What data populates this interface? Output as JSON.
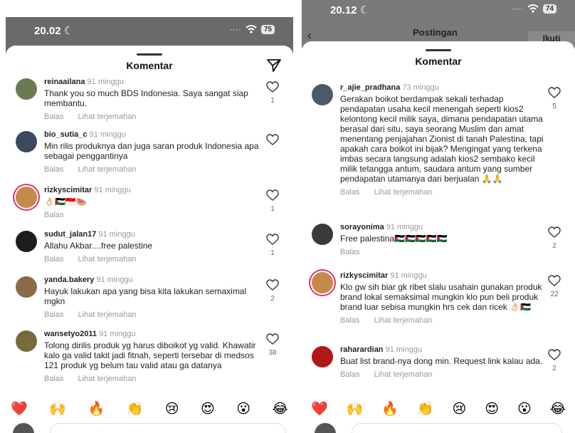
{
  "left": {
    "status_time": "20.02 ☾",
    "battery": "75",
    "sheet_title": "Komentar",
    "reply_label": "Balas",
    "translate_label": "Lihat terjemahan",
    "comments": [
      {
        "username": "reinaailana",
        "time": "91 minggu",
        "text": "Thank you so much BDS Indonesia. Saya sangat siap membantu.",
        "likes": "1",
        "translate": true
      },
      {
        "username": "bio_sutia_c",
        "time": "91 minggu",
        "text": "Min rilis produknya dan juga saran produk Indonesia apa sebagai penggantinya",
        "likes": "",
        "translate": true
      },
      {
        "username": "rizkyscimitar",
        "time": "91 minggu",
        "text": "👌🏻🇵🇸🇮🇩🍉",
        "likes": "1",
        "translate": false
      },
      {
        "username": "sudut_jalan17",
        "time": "91 minggu",
        "text": "Allahu Akbar....free palestine",
        "likes": "1",
        "translate": true
      },
      {
        "username": "yanda.bakery",
        "time": "91 minggu",
        "text": "Hayuk lakukan apa yang bisa kita lakukan semaximal mgkn",
        "likes": "2",
        "translate": true
      },
      {
        "username": "wansetyo2011",
        "time": "91 minggu",
        "text": "Tolong dirilis produk yg harus diboikot yg valid. Khawatir kalo ga valid takit jadi fitnah, seperti tersebar di medsos 121 produk yg belum tau valid atau ga datanya",
        "likes": "38",
        "translate": true
      }
    ],
    "emojis": [
      "❤️",
      "🙌",
      "🔥",
      "👏",
      "😢",
      "😍",
      "😮",
      "😂"
    ]
  },
  "right": {
    "status_time": "20.12 ☾",
    "battery": "74",
    "header_title": "Postingan",
    "follow_label": "Ikuti",
    "sheet_title": "Komentar",
    "reply_label": "Balas",
    "translate_label": "Lihat terjemahan",
    "comments": [
      {
        "username": "r_ajie_pradhana",
        "time": "73 minggu",
        "text": "Gerakan boikot berdampak sekali terhadap pendapatan usaha kecil menengah seperti kios2 kelontong kecil milik saya, dimana pendapatan utama berasal dari situ, saya seorang Muslim dan amat menentang penjajahan Zionist di tanah Palestina, tapi apakah cara boikot ini bijak? Mengingat yang terkena imbas secara langsung adalah kios2 sembako kecil milik tetangga antum, saudara antum yang sumber pendapatan utamanya dari berjualan 🙏🙏",
        "likes": "5",
        "translate": true
      },
      {
        "username": "sorayonima",
        "time": "91 minggu",
        "text": "Free palestina🇵🇸🇵🇸🇵🇸🇵🇸🇵🇸",
        "likes": "2",
        "translate": false
      },
      {
        "username": "rizkyscimitar",
        "time": "91 minggu",
        "text": "Klo gw sih biar gk ribet slalu usahain gunakan produk brand lokal semaksimal mungkin klo pun beli produk brand luar sebisa mungkin hrs cek dan ricek 👌🏻🇵🇸",
        "likes": "22",
        "translate": true
      },
      {
        "username": "raharardian",
        "time": "91 minggu",
        "text": "Buat list brand-nya dong min. Request link kalau ada.",
        "likes": "2",
        "translate": true
      }
    ],
    "emojis": [
      "❤️",
      "🙌",
      "🔥",
      "👏",
      "😢",
      "😍",
      "😮",
      "😂"
    ]
  }
}
